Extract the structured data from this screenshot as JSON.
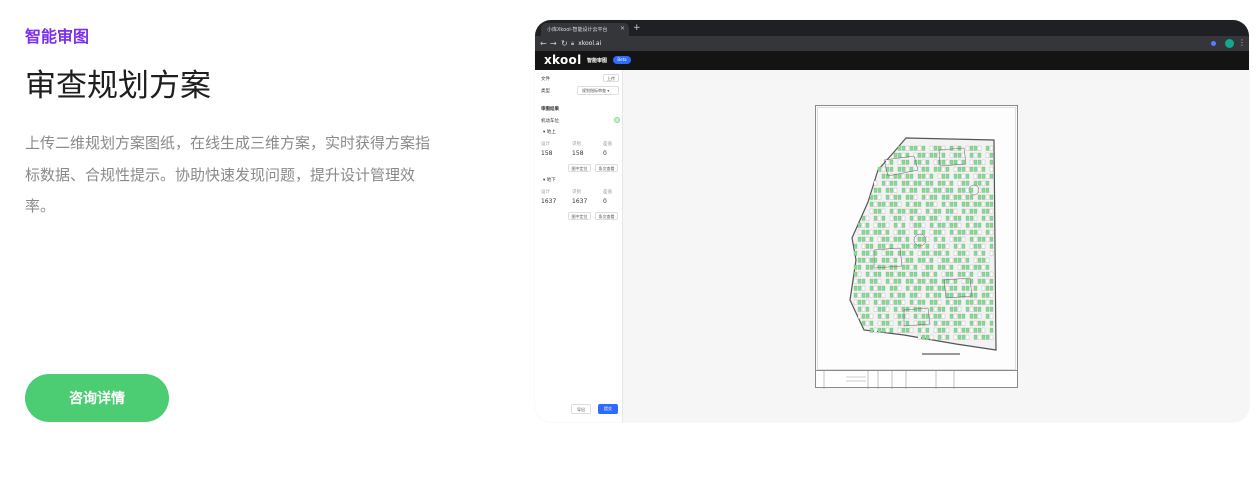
{
  "section": {
    "eyebrow": "智能审图",
    "headline": "审查规划方案",
    "description": "上传二维规划方案图纸，在线生成三维方案，实时获得方案指标数据、合规性提示。协助快速发现问题，提升设计管理效率。",
    "cta_label": "咨询详情"
  },
  "browser": {
    "tab_title": "小库Xkool-智能设计云平台",
    "url": "xkool.ai",
    "app_logo": "xkool",
    "app_nav_title": "智能审图",
    "beta_badge": "Beta",
    "icons": {
      "back": "arrow-left-icon",
      "forward": "arrow-right-icon",
      "reload": "reload-icon",
      "lock": "lock-icon",
      "tab_close": "close-icon",
      "new_tab": "plus-icon",
      "menu": "kebab-menu-icon"
    }
  },
  "panel": {
    "file_label": "文件",
    "upload_label": "上传",
    "type_label": "类型",
    "type_value": "规划指标审查",
    "results_label": "审图结果",
    "parking_label": "机动车位",
    "above_ground_label": "地上",
    "below_ground_label": "地下",
    "col_design": "设计",
    "col_check": "识别",
    "col_diff": "差值",
    "above_values": [
      "158",
      "158",
      "0"
    ],
    "below_values": [
      "1637",
      "1637",
      "0"
    ],
    "locate_label": "图中定位",
    "detail_label": "条文查看",
    "export_label": "导出",
    "submit_label": "提交"
  },
  "colors": {
    "eyebrow": "#7b2ff0",
    "cta": "#4ccd73",
    "accent_blue": "#2f6bff",
    "parking_green": "#7ee08c"
  }
}
